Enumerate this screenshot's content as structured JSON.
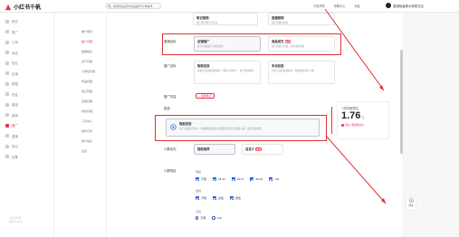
{
  "app": {
    "logo_text": "小红书千帆"
  },
  "search": {
    "placeholder": "搜索商品名称/商品编号/订单编号"
  },
  "top_links": [
    "千帆学院",
    "帮助中心",
    "消息"
  ],
  "user": {
    "name": "墨绿色装修大师官方店"
  },
  "sidebar": {
    "items": [
      {
        "label": "首页",
        "active": false
      },
      {
        "label": "推广",
        "active": false
      },
      {
        "label": "订单",
        "active": false
      },
      {
        "label": "商品",
        "active": false
      },
      {
        "label": "售后",
        "active": false
      },
      {
        "label": "店铺",
        "active": false
      },
      {
        "label": "数据",
        "active": false
      },
      {
        "label": "资金",
        "active": false
      },
      {
        "label": "客服",
        "active": false
      },
      {
        "label": "营销",
        "active": false
      },
      {
        "label": "推广",
        "active": true
      },
      {
        "label": "直播",
        "active": false
      },
      {
        "label": "笔记",
        "active": false
      },
      {
        "label": "设置",
        "active": false
      }
    ],
    "footer": [
      "小红书千帆",
      "版本号 1.0.0"
    ]
  },
  "sub_nav": [
    {
      "label": "推广概览",
      "active": false
    },
    {
      "label": "推广管理",
      "active": true
    },
    {
      "label": "数据报表",
      "active": false
    },
    {
      "label": "资产管理",
      "active": false
    },
    {
      "label": "人群包管理",
      "active": false
    },
    {
      "label": "商品管理",
      "active": false
    },
    {
      "label": "笔记管理",
      "active": false
    },
    {
      "label": "直播管理",
      "active": false
    },
    {
      "label": "财务管理",
      "active": false
    },
    {
      "label": "工具中心",
      "active": false
    },
    {
      "label": "操作日志",
      "active": false
    },
    {
      "label": "账户信息",
      "active": false
    },
    {
      "label": "设置",
      "active": false
    }
  ],
  "form": {
    "top_cards": [
      {
        "title": "笔记营销",
        "desc": "提升笔记曝光与互动"
      },
      {
        "title": "直播营销",
        "desc": "提升直播间热度"
      }
    ],
    "marketing_goal": {
      "label": "营销目标",
      "options": [
        {
          "title": "店铺推广",
          "desc": "提升店铺进店与成交效果",
          "badge": ""
        },
        {
          "title": "商品成交",
          "desc": "提升商品订单量，优化成交效果",
          "badge": "推荐"
        }
      ]
    },
    "placement": {
      "label": "推广目标",
      "options": [
        {
          "title": "智能投放",
          "desc": "系统自动选择投放版位，覆盖人群更广，提升投放效果"
        },
        {
          "title": "手动投放",
          "desc": "自定义选择投放版位，精准触达目标人群"
        }
      ]
    },
    "content": {
      "label": "推广内容",
      "button": "+ 选择笔记"
    },
    "smart": {
      "label": "投放",
      "title": "智能投放",
      "desc": "在广告投放过程中，系统根据投放目标智能优化出价与投放人群，提升投放效果"
    },
    "audience": {
      "label": "人群定向",
      "options": [
        {
          "title": "智能推荐",
          "badge": ""
        },
        {
          "title": "自定义",
          "badge": "推荐"
        }
      ]
    },
    "targeting": {
      "label": "人群特征",
      "age_label": "年龄",
      "ages": [
        "不限",
        "18-22",
        "23-27",
        "28-32",
        ">32"
      ],
      "gender_label": "性别",
      "genders": [
        "不限",
        "女性",
        "男性"
      ],
      "platform_label": "平台",
      "platforms": [
        "不限",
        "iOS"
      ]
    }
  },
  "estimate": {
    "title": "人群规模预估",
    "value": "1.76",
    "unit": "亿",
    "note": "预估人群规模适中"
  },
  "help": {
    "label": "帮助"
  },
  "colors": {
    "accent": "#e6344a",
    "annotation": "#e03131",
    "checkbox": "#1f5fd6"
  }
}
